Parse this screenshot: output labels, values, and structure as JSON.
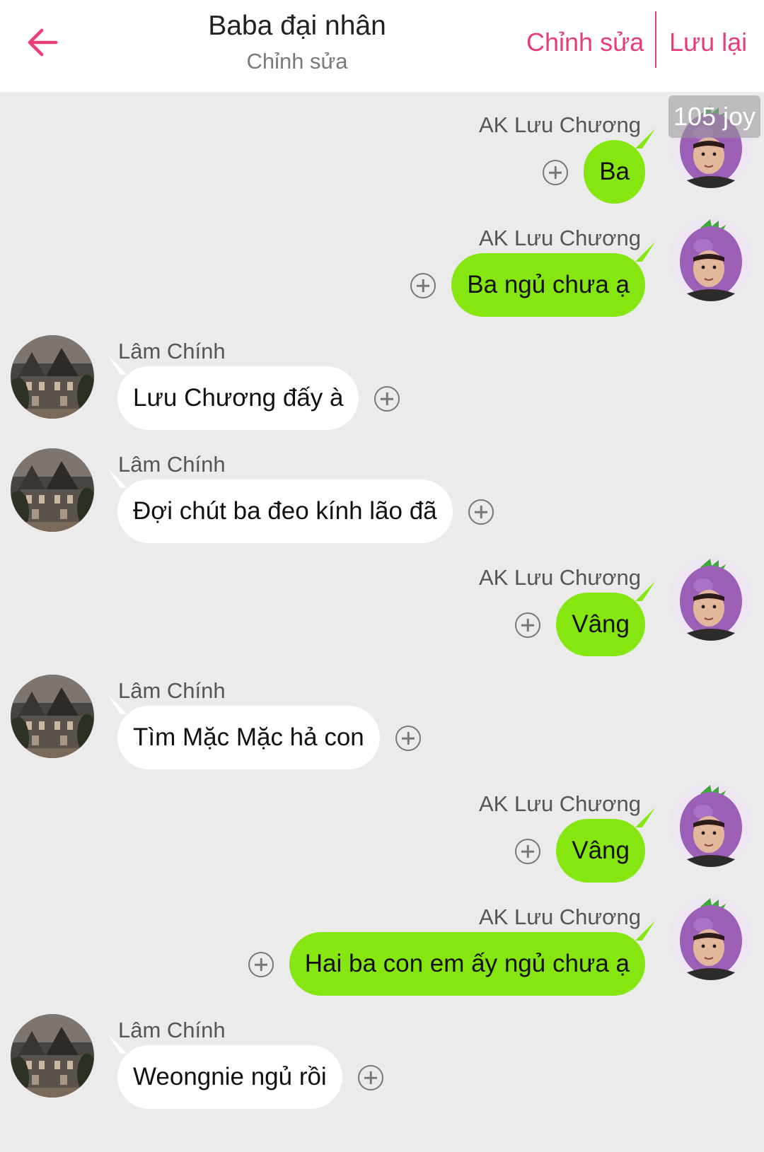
{
  "header": {
    "title": "Baba đại nhân",
    "subtitle": "Chỉnh sửa",
    "edit_label": "Chỉnh sửa",
    "save_label": "Lưu lại"
  },
  "badge": {
    "joy": "105 joy"
  },
  "colors": {
    "accent": "#e83e78",
    "outgoing_bubble": "#86e60f",
    "incoming_bubble": "#ffffff",
    "background": "#ebebeb"
  },
  "messages": [
    {
      "direction": "out",
      "sender": "AK Lưu Chương",
      "text": "Ba",
      "avatar": "eggplant-hat-avatar"
    },
    {
      "direction": "out",
      "sender": "AK Lưu Chương",
      "text": "Ba ngủ chưa ạ",
      "avatar": "eggplant-hat-avatar"
    },
    {
      "direction": "in",
      "sender": "Lâm Chính",
      "text": "Lưu Chương đấy à",
      "avatar": "mansion-avatar"
    },
    {
      "direction": "in",
      "sender": "Lâm Chính",
      "text": "Đợi chút ba đeo kính lão đã",
      "avatar": "mansion-avatar"
    },
    {
      "direction": "out",
      "sender": "AK Lưu Chương",
      "text": "Vâng",
      "avatar": "eggplant-hat-avatar"
    },
    {
      "direction": "in",
      "sender": "Lâm Chính",
      "text": "Tìm Mặc Mặc hả con",
      "avatar": "mansion-avatar"
    },
    {
      "direction": "out",
      "sender": "AK Lưu Chương",
      "text": "Vâng",
      "avatar": "eggplant-hat-avatar"
    },
    {
      "direction": "out",
      "sender": "AK Lưu Chương",
      "text": "Hai ba con em ấy ngủ chưa ạ",
      "avatar": "eggplant-hat-avatar"
    },
    {
      "direction": "in",
      "sender": "Lâm Chính",
      "text": "Weongnie ngủ rồi",
      "avatar": "mansion-avatar"
    }
  ]
}
